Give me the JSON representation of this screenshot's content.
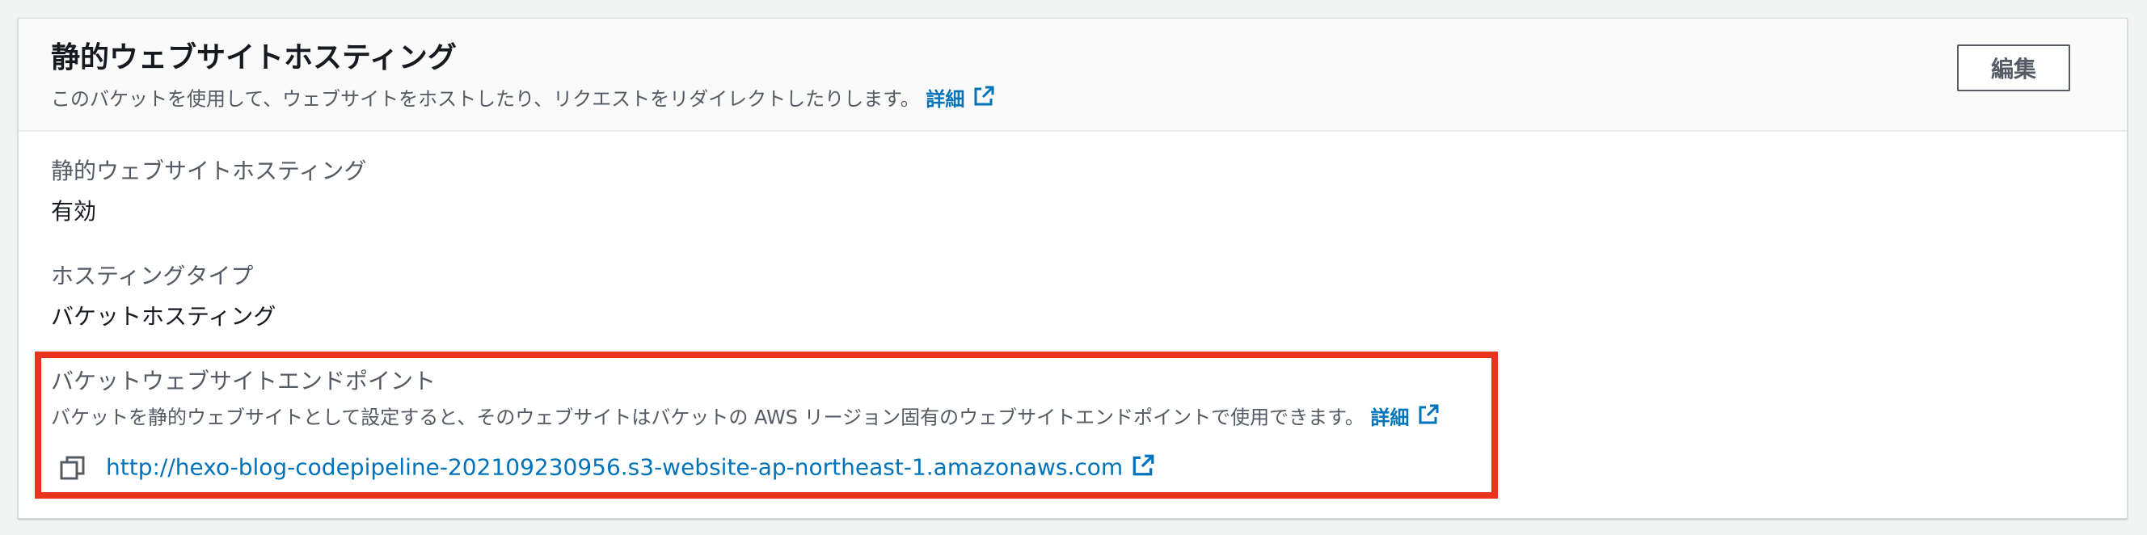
{
  "header": {
    "title": "静的ウェブサイトホスティング",
    "description": "このバケットを使用して、ウェブサイトをホストしたり、リクエストをリダイレクトしたりします。",
    "details_link": "詳細",
    "edit_button": "編集"
  },
  "fields": {
    "static_hosting_label": "静的ウェブサイトホスティング",
    "static_hosting_value": "有効",
    "hosting_type_label": "ホスティングタイプ",
    "hosting_type_value": "バケットホスティング",
    "endpoint_label": "バケットウェブサイトエンドポイント",
    "endpoint_description": "バケットを静的ウェブサイトとして設定すると、そのウェブサイトはバケットの AWS リージョン固有のウェブサイトエンドポイントで使用できます。",
    "endpoint_details_link": "詳細",
    "endpoint_url": "http://hexo-blog-codepipeline-202109230956.s3-website-ap-northeast-1.amazonaws.com"
  },
  "icons": {
    "external": "external-link-icon",
    "copy": "copy-icon"
  },
  "colors": {
    "link": "#0073bb",
    "highlight": "#e8341c",
    "text": "#16191f",
    "muted": "#545b64"
  }
}
